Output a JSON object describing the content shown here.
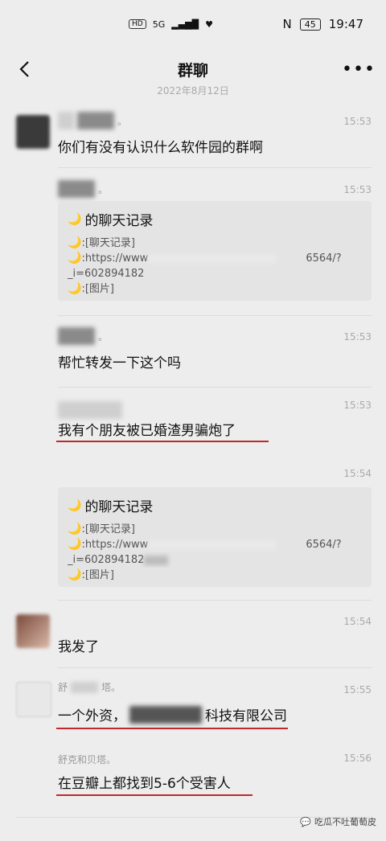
{
  "status": {
    "hd": "HD",
    "net": "5G",
    "nfc": "N",
    "battery": "45",
    "time": "19:47"
  },
  "header": {
    "title": "群聊",
    "more": "•••"
  },
  "date_sep": "2022年8月12日",
  "messages": {
    "m1": {
      "time": "15:53",
      "text": "你们有没有认识什么软件园的群啊",
      "name_suffix": "。"
    },
    "m2": {
      "time": "15:53",
      "name_suffix": "。",
      "card": {
        "title": "的聊天记录",
        "l1": ":[聊天记录]",
        "l2a": ":https://www",
        "l2b": "6564/?",
        "l3": "_i=602894182",
        "l4": ":[图片]"
      }
    },
    "m3": {
      "time": "15:53",
      "text": "帮忙转发一下这个吗",
      "name_suffix": "。"
    },
    "m4": {
      "time": "15:53",
      "text": "我有个朋友被已婚渣男骗炮了"
    },
    "m5": {
      "time": "15:54",
      "card": {
        "title": "的聊天记录",
        "l1": ":[聊天记录]",
        "l2a": ":https://www",
        "l2b": "6564/?",
        "l3": "_i=602894182",
        "l4": ":[图片]"
      }
    },
    "m6": {
      "time": "15:54",
      "text": "我发了"
    },
    "m7": {
      "time": "15:55",
      "name_a": "舒",
      "name_b": "塔。",
      "text_a": "一个外资，",
      "text_b": "科技有限公司"
    },
    "m8": {
      "time": "15:56",
      "name": "舒克和贝塔。",
      "text": "在豆瓣上都找到5-6个受害人"
    }
  },
  "watermark": "吃瓜不吐葡萄皮",
  "colors": {
    "underline": "#c0282d",
    "background": "#ededed"
  }
}
